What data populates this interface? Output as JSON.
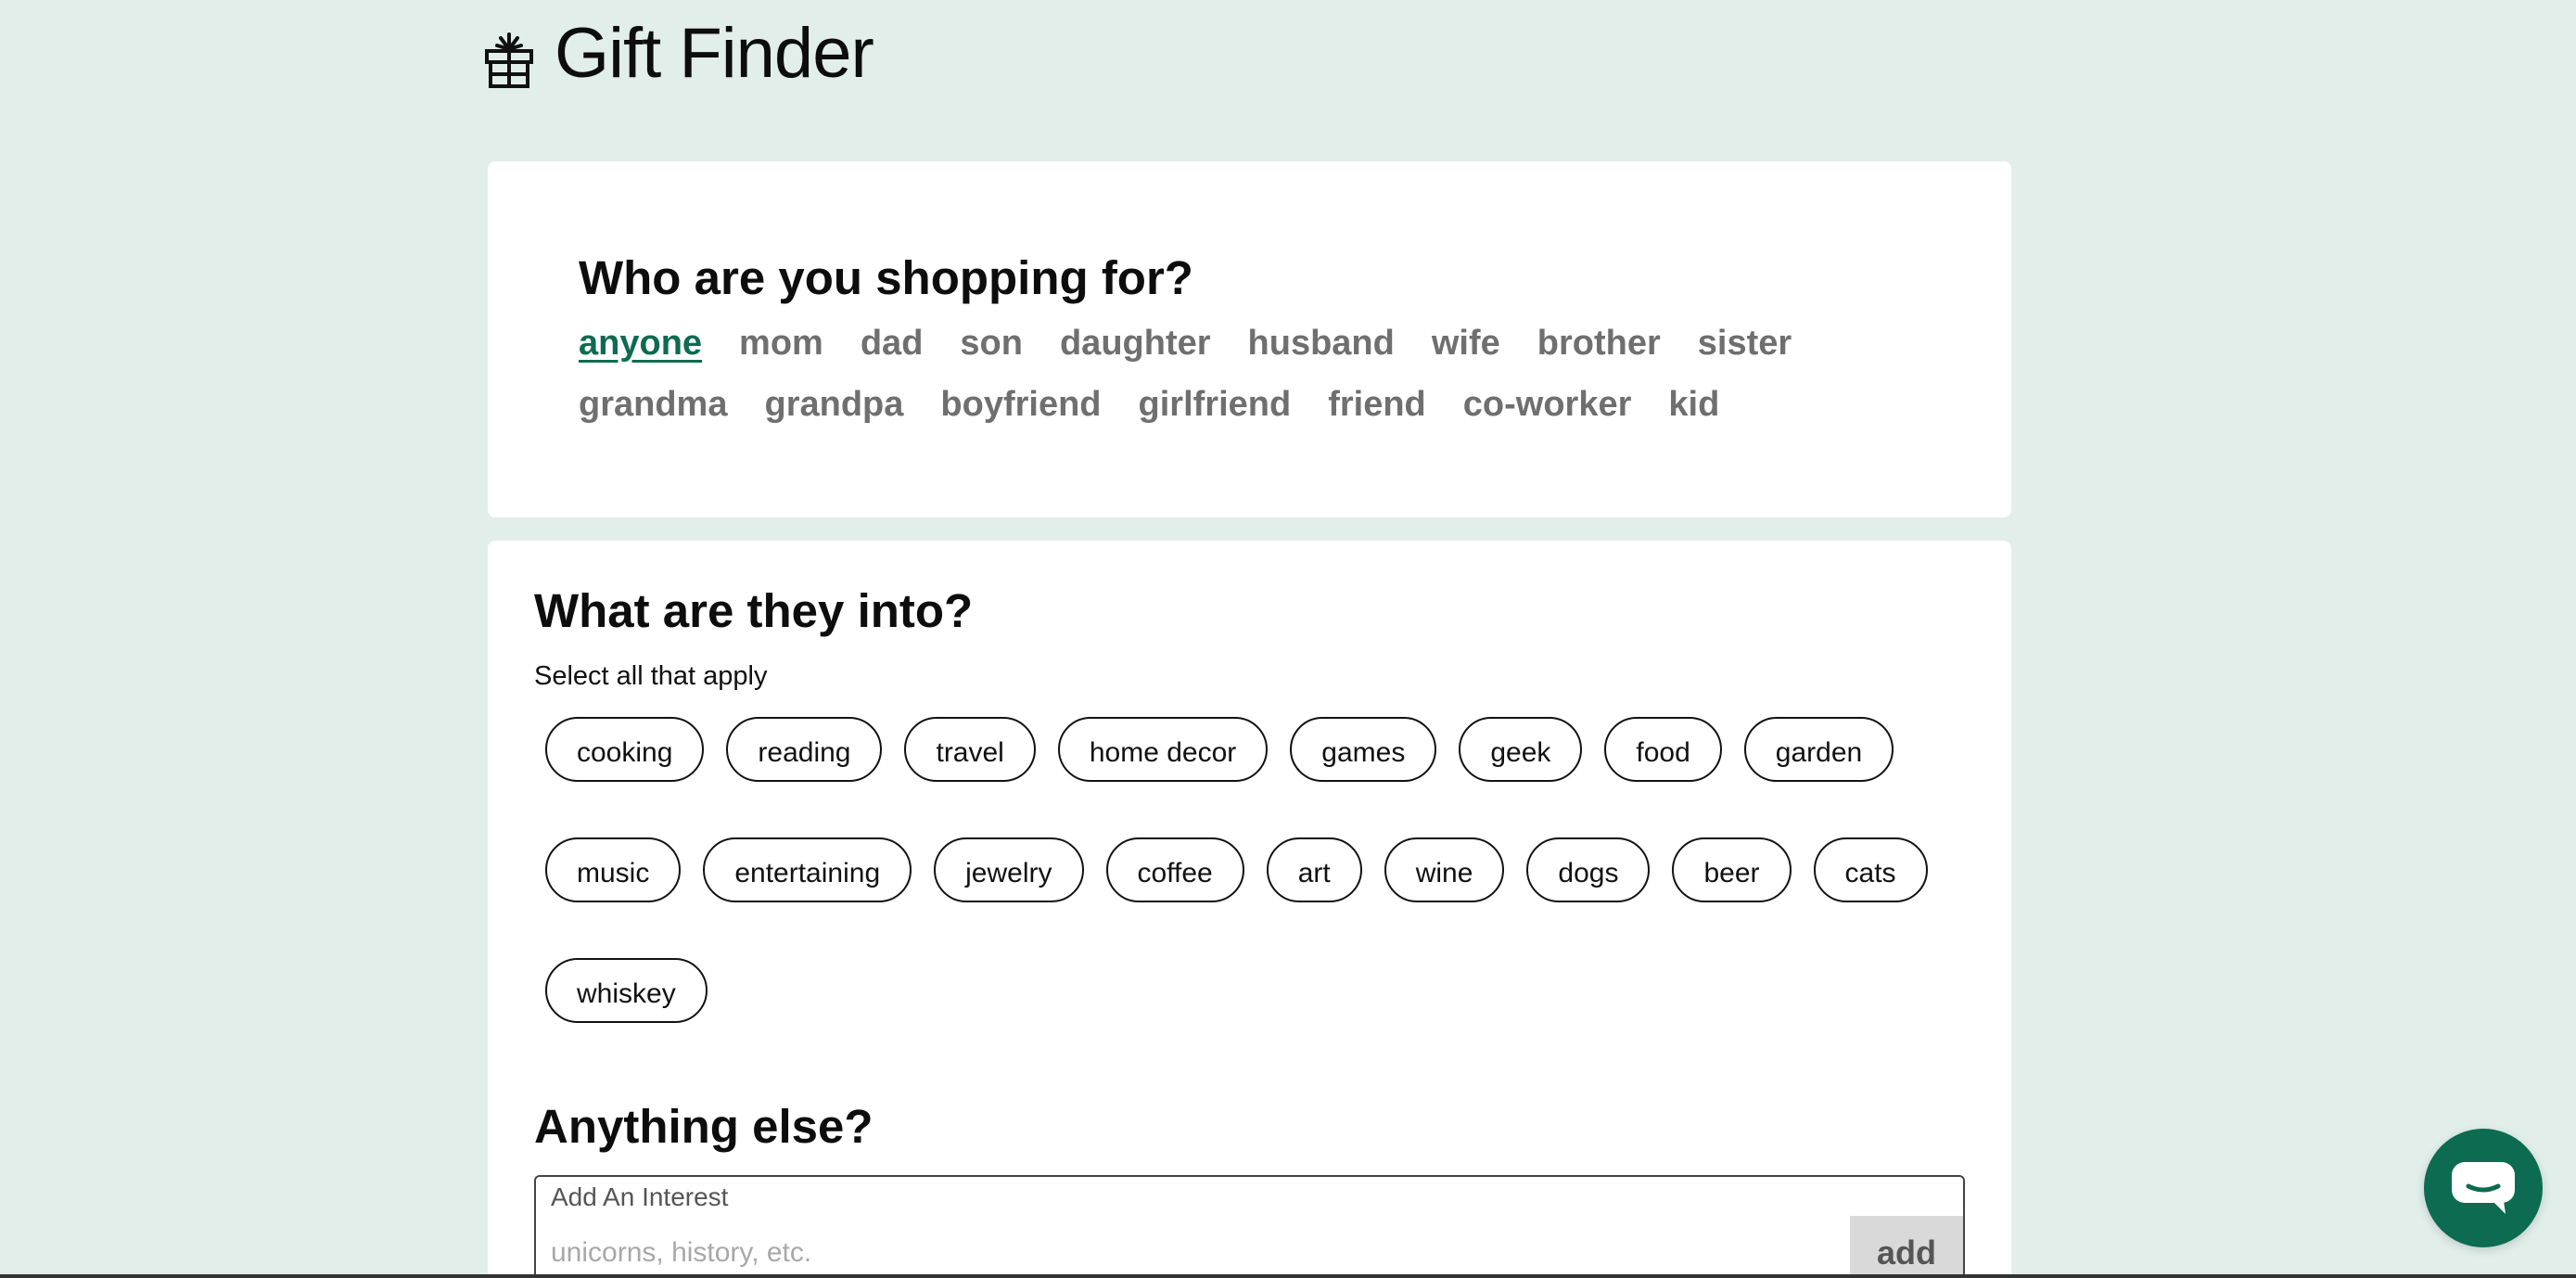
{
  "header": {
    "title": "Gift Finder",
    "icon": "gift-icon"
  },
  "who": {
    "heading": "Who are you shopping for?",
    "selected": "anyone",
    "recipients": [
      "anyone",
      "mom",
      "dad",
      "son",
      "daughter",
      "husband",
      "wife",
      "brother",
      "sister",
      "grandma",
      "grandpa",
      "boyfriend",
      "girlfriend",
      "friend",
      "co-worker",
      "kid"
    ]
  },
  "interests": {
    "heading": "What are they into?",
    "subtext": "Select all that apply",
    "row1": [
      "cooking",
      "reading",
      "travel",
      "home decor",
      "games",
      "geek",
      "food",
      "garden"
    ],
    "row2": [
      "music",
      "entertaining",
      "jewelry",
      "coffee",
      "art",
      "wine",
      "dogs",
      "beer",
      "cats"
    ],
    "row3": [
      "whiskey"
    ]
  },
  "anything_else": {
    "heading": "Anything else?",
    "input_label": "Add An Interest",
    "input_placeholder": "unicorns, history, etc.",
    "input_value": "",
    "add_label": "add"
  },
  "chat": {
    "icon": "chat-icon"
  },
  "colors": {
    "background": "#e1eeea",
    "accent": "#0d6b4f",
    "chat": "#0c6b50",
    "muted_text": "#6f6f6f"
  }
}
